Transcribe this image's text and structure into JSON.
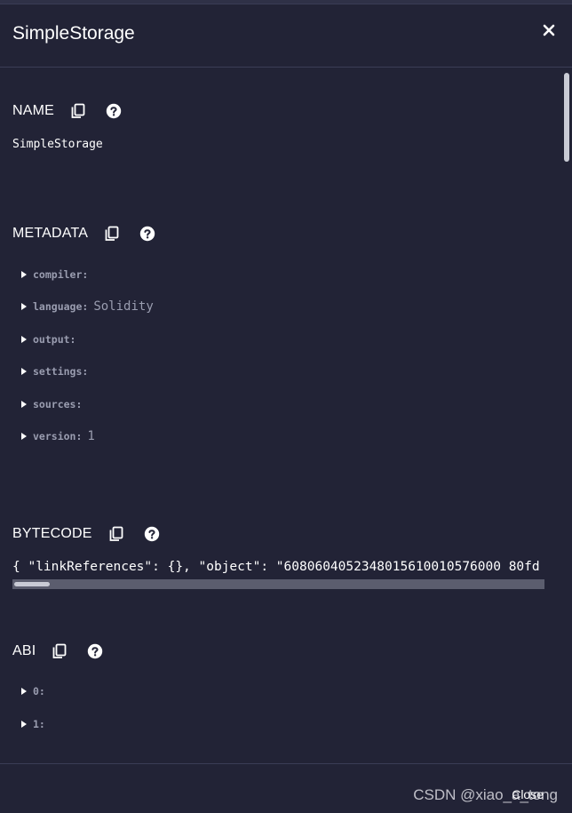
{
  "modal": {
    "title": "SimpleStorage",
    "footer_close_label": "Close"
  },
  "sections": {
    "name": {
      "label": "NAME",
      "value": "SimpleStorage"
    },
    "metadata": {
      "label": "METADATA",
      "items": [
        {
          "key": "compiler:",
          "value": ""
        },
        {
          "key": "language:",
          "value": "Solidity"
        },
        {
          "key": "output:",
          "value": ""
        },
        {
          "key": "settings:",
          "value": ""
        },
        {
          "key": "sources:",
          "value": ""
        },
        {
          "key": "version:",
          "value": "1"
        }
      ]
    },
    "bytecode": {
      "label": "BYTECODE",
      "value": "{ \"linkReferences\": {}, \"object\": \"6080604052348015610010576000 80fd"
    },
    "abi": {
      "label": "ABI",
      "items": [
        {
          "key": "0:"
        },
        {
          "key": "1:"
        }
      ]
    }
  },
  "icons": {
    "copy": "copy-icon",
    "help": "help-icon",
    "close": "close-icon",
    "caret": "caret-right-icon"
  },
  "watermark": "CSDN @xiao_a_tong"
}
